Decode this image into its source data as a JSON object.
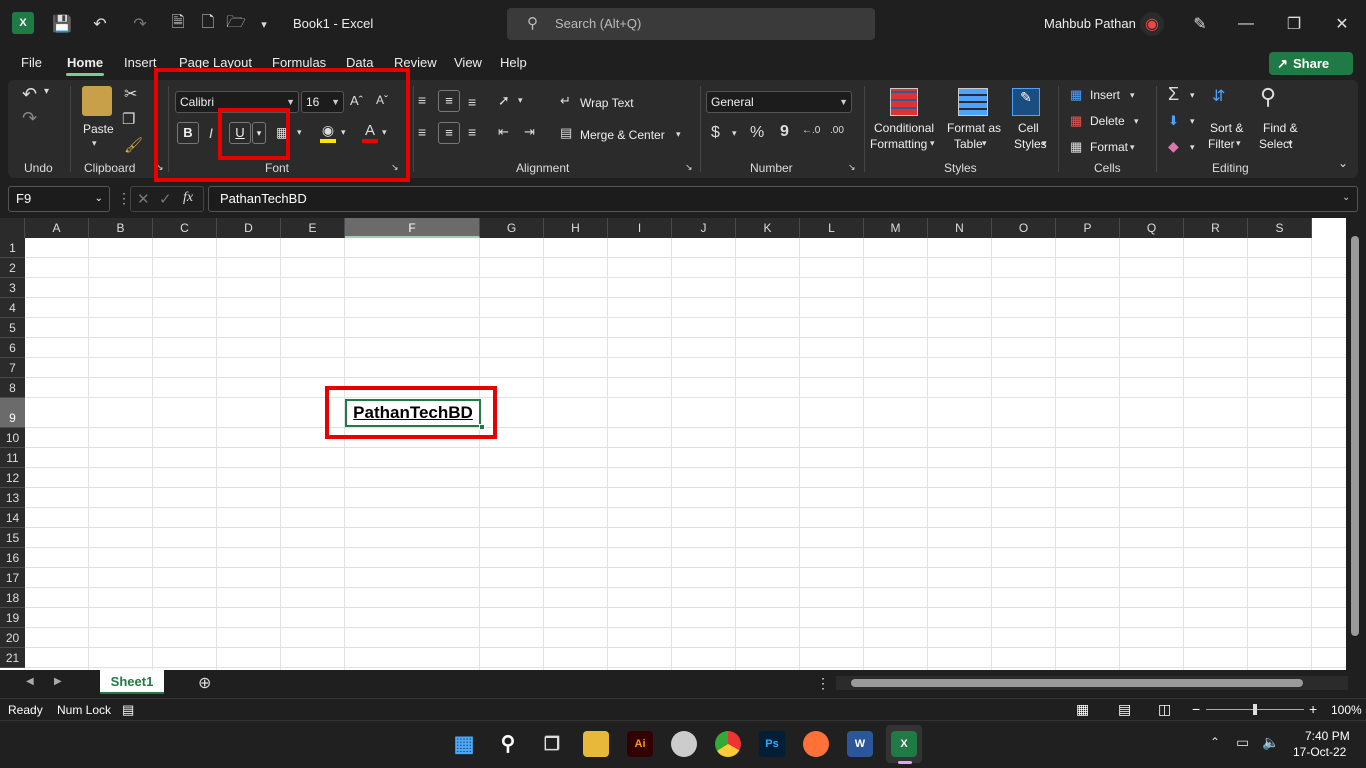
{
  "titlebar": {
    "doc_title": "Book1  -  Excel",
    "search_placeholder": "Search (Alt+Q)",
    "user_name": "Mahbub Pathan"
  },
  "menu": {
    "file": "File",
    "home": "Home",
    "insert": "Insert",
    "page_layout": "Page Layout",
    "formulas": "Formulas",
    "data": "Data",
    "review": "Review",
    "view": "View",
    "help": "Help",
    "share": "Share"
  },
  "ribbon": {
    "undo_label": "Undo",
    "clipboard": {
      "label": "Clipboard",
      "paste": "Paste"
    },
    "font": {
      "label": "Font",
      "font_name": "Calibri",
      "font_size": "16",
      "bold": "B",
      "italic": "I",
      "underline": "U",
      "font_color_glyph": "A"
    },
    "alignment": {
      "label": "Alignment",
      "wrap_text": "Wrap Text",
      "merge_center": "Merge & Center"
    },
    "number": {
      "label": "Number",
      "format": "General",
      "currency": "$",
      "percent": "%",
      "comma": "9"
    },
    "styles": {
      "label": "Styles",
      "conditional_1": "Conditional",
      "conditional_2": "Formatting",
      "format_table_1": "Format as",
      "format_table_2": "Table",
      "cell_styles_1": "Cell",
      "cell_styles_2": "Styles"
    },
    "cells": {
      "label": "Cells",
      "insert": "Insert",
      "delete": "Delete",
      "format": "Format"
    },
    "editing": {
      "label": "Editing",
      "sort_1": "Sort &",
      "sort_2": "Filter",
      "find_1": "Find &",
      "find_2": "Select"
    }
  },
  "formula_bar": {
    "name_box": "F9",
    "fx": "fx",
    "content": "PathanTechBD"
  },
  "grid": {
    "columns": [
      "A",
      "B",
      "C",
      "D",
      "E",
      "F",
      "G",
      "H",
      "I",
      "J",
      "K",
      "L",
      "M",
      "N",
      "O",
      "P",
      "Q",
      "R",
      "S"
    ],
    "rows": [
      "1",
      "2",
      "3",
      "4",
      "5",
      "6",
      "7",
      "8",
      "9",
      "10",
      "11",
      "12",
      "13",
      "14",
      "15",
      "16",
      "17",
      "18",
      "19",
      "20",
      "21"
    ],
    "selected_col": "F",
    "selected_row": "9",
    "cell_f9": "PathanTechBD"
  },
  "sheets": {
    "tab1": "Sheet1"
  },
  "status": {
    "ready": "Ready",
    "numlock": "Num Lock",
    "zoom": "100%"
  },
  "taskbar": {
    "time": "7:40 PM",
    "date": "17-Oct-22"
  }
}
